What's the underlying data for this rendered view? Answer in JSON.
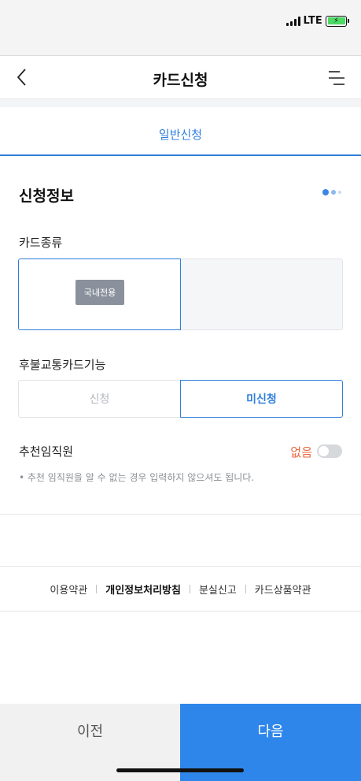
{
  "status_bar": {
    "network": "LTE",
    "battery_charging": true,
    "battery_color": "#4cd964"
  },
  "nav": {
    "title": "카드신청",
    "back_icon": "chevron-left-icon",
    "menu_icon": "menu-icon"
  },
  "tab": {
    "label": "일반신청"
  },
  "section": {
    "title": "신청정보",
    "page_indicator": {
      "current": 1,
      "total": 3
    }
  },
  "card_type": {
    "label": "카드종류",
    "options": [
      {
        "badge": "국내전용",
        "selected": true
      },
      {
        "badge": "",
        "selected": false
      }
    ]
  },
  "transit": {
    "label": "후불교통카드기능",
    "options": [
      "신청",
      "미신청"
    ],
    "selected": "미신청"
  },
  "recommender": {
    "label": "추천임직원",
    "status": "없음",
    "toggle_on": false,
    "hint": "• 추천 임직원을 알 수 없는 경우 입력하지 않으셔도 됩니다."
  },
  "footer_links": [
    "이용약관",
    "개인정보처리방침",
    "분실신고",
    "카드상품약관"
  ],
  "buttons": {
    "prev": "이전",
    "next": "다음"
  },
  "colors": {
    "accent": "#2f7fdc",
    "next_button": "#2f86ea",
    "none_text": "#e8643a"
  }
}
